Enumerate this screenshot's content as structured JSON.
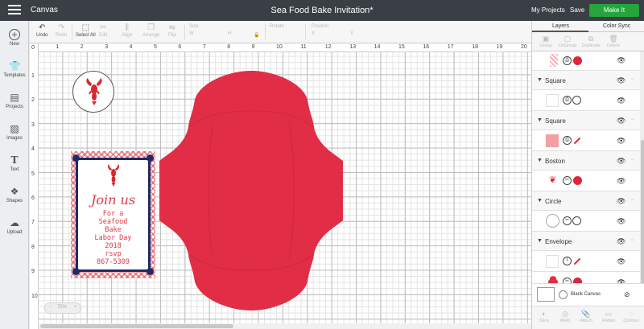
{
  "colors": {
    "titlebar": "#3a3f45",
    "make_it": "#25a53c",
    "envelope_red": "#e22d46",
    "navy": "#1f2a66",
    "accent_red": "#e03945"
  },
  "titlebar": {
    "app_name": "Canvas",
    "doc_title": "Sea Food Bake Invitation*",
    "my_projects": "My Projects",
    "save": "Save",
    "make_it": "Make It"
  },
  "sidebar": [
    {
      "label": "New",
      "icon": "plus-icon"
    },
    {
      "label": "Templates",
      "icon": "shirt-icon"
    },
    {
      "label": "Projects",
      "icon": "projects-icon"
    },
    {
      "label": "Images",
      "icon": "images-icon"
    },
    {
      "label": "Text",
      "icon": "text-icon"
    },
    {
      "label": "Shapes",
      "icon": "shapes-icon"
    },
    {
      "label": "Upload",
      "icon": "upload-icon"
    }
  ],
  "toolbar": {
    "undo": "Undo",
    "redo": "Redo",
    "select_all": "Select All",
    "edit": "Edit",
    "align": "Align",
    "arrange": "Arrange",
    "flip": "Flip",
    "size": "Size",
    "w": "W",
    "h": "H",
    "rotate": "Rotate",
    "position": "Position",
    "x": "X",
    "y": "Y"
  },
  "ruler": {
    "top": [
      "0",
      "1",
      "2",
      "3",
      "4",
      "5",
      "6",
      "7",
      "8",
      "9",
      "10",
      "11",
      "12",
      "13",
      "14",
      "15",
      "16",
      "17",
      "18",
      "19",
      "20"
    ],
    "left": [
      "1",
      "2",
      "3",
      "4",
      "5",
      "6",
      "7",
      "8",
      "9",
      "10"
    ]
  },
  "invitation": {
    "heading": "Join us",
    "lines": [
      "For a",
      "Seafood",
      "Bake",
      "Labor Day",
      "2018",
      "rsvp",
      "867-5309"
    ]
  },
  "zoom": {
    "level": "75%",
    "minus": "−",
    "plus": "+"
  },
  "panel": {
    "tabs": [
      "Layers",
      "Color Sync"
    ],
    "tools": [
      "Group",
      "UnGroup",
      "Duplicate",
      "Delete"
    ],
    "groups": [
      "Square",
      "Square",
      "Boston",
      "Circle",
      "Envelope"
    ],
    "blank_canvas": "Blank Canvas",
    "bottom_tools": [
      "Slice",
      "Weld",
      "Attach",
      "Flatten",
      "Contour"
    ]
  }
}
